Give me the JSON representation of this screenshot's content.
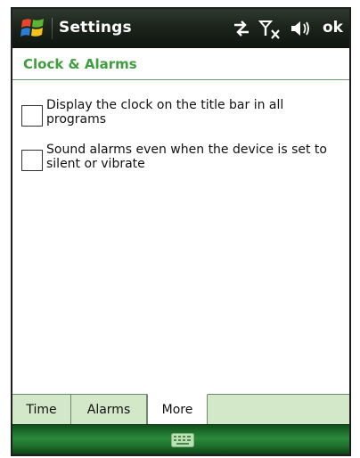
{
  "titlebar": {
    "app_title": "Settings",
    "ok_label": "ok",
    "icons": [
      "windows-start-icon",
      "connectivity-icon",
      "no-signal-icon",
      "speaker-icon"
    ]
  },
  "page": {
    "title": "Clock & Alarms"
  },
  "options": [
    {
      "label": "Display the clock on the title bar in all programs",
      "checked": false
    },
    {
      "label": "Sound alarms even when the device is set to silent or vibrate",
      "checked": false
    }
  ],
  "tabs": [
    {
      "label": "Time",
      "selected": false
    },
    {
      "label": "Alarms",
      "selected": false
    },
    {
      "label": "More",
      "selected": true
    }
  ],
  "softkeys": {
    "icons": [
      "keyboard-icon"
    ]
  },
  "colors": {
    "accent_green": "#3f9f3f",
    "tab_bar_bg": "#d3e8c9",
    "title_bar_bg": "#1c241c",
    "softkey_bar_bg": "#2b8a3a"
  }
}
